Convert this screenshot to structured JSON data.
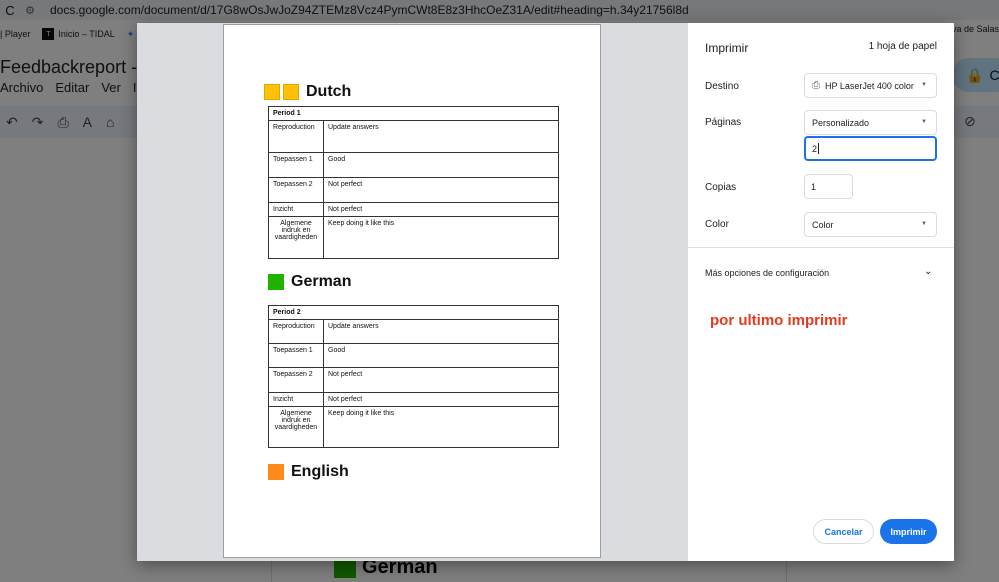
{
  "browser": {
    "url": "docs.google.com/document/d/17G8wOsJwJoZ94ZTEMz8Vcz4PymCWt8E8z3HhcOeZ31A/edit#heading=h.34y21756l8d",
    "reload_icon": "C",
    "bookmarks": [
      {
        "label": "| Player"
      },
      {
        "label": "Inicio – TIDAL",
        "icon": "T"
      },
      {
        "label": "✦"
      }
    ],
    "bookmark_right": "rva de Salas"
  },
  "docs": {
    "title": "Feedbackreport - G",
    "menus": [
      "Archivo",
      "Editar",
      "Ver",
      "I"
    ],
    "share_label": "C",
    "bg_heading": "German"
  },
  "print_dialog": {
    "title": "Imprimir",
    "sheet_count": "1 hoja de papel",
    "destination_label": "Destino",
    "destination_value": "HP LaserJet 400 color",
    "pages_label": "Páginas",
    "pages_value": "Personalizado",
    "pages_input": "2",
    "copies_label": "Copias",
    "copies_value": "1",
    "color_label": "Color",
    "color_value": "Color",
    "more_options": "Más opciones de configuración",
    "annotation": "por ultimo imprimir",
    "cancel": "Cancelar",
    "print": "Imprimir"
  },
  "preview": {
    "dutch": {
      "heading": "Dutch",
      "period": "Period 1",
      "rows": [
        {
          "k": "Reproduction",
          "v": "Update answers"
        },
        {
          "k": "Toepassen 1",
          "v": "Good"
        },
        {
          "k": "Toepassen 2",
          "v": "Not perfect"
        },
        {
          "k": "Inzicht",
          "v": "Not perfect"
        },
        {
          "k": "Algemene indruk en vaardigheden",
          "v": "Keep doing it like this"
        }
      ]
    },
    "german": {
      "heading": "German",
      "period": "Period 2",
      "rows": [
        {
          "k": "Reproduction",
          "v": "Update answers"
        },
        {
          "k": "Toepassen 1",
          "v": "Good"
        },
        {
          "k": "Toepassen 2",
          "v": "Not perfect"
        },
        {
          "k": "Inzicht",
          "v": "Not perfect"
        },
        {
          "k": "Algemene indruk en vaardigheden",
          "v": "Keep doing it like this"
        }
      ]
    },
    "english": {
      "heading": "English"
    }
  }
}
